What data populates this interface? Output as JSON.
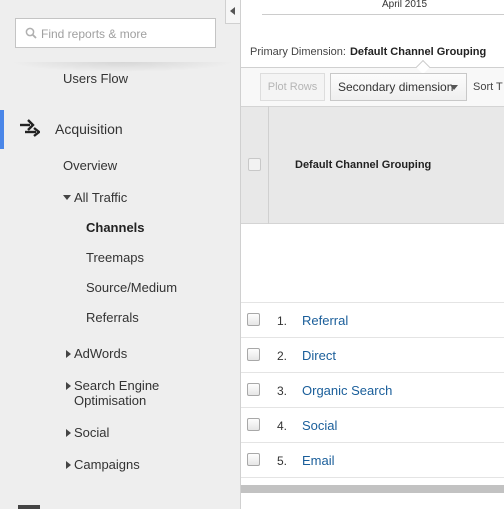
{
  "sidebar": {
    "search_placeholder": "Find reports & more",
    "users_flow": "Users Flow",
    "section_title": "Acquisition",
    "overview": "Overview",
    "all_traffic": "All Traffic",
    "all_traffic_items": [
      "Channels",
      "Treemaps",
      "Source/Medium",
      "Referrals"
    ],
    "adwords": "AdWords",
    "seo_line1": "Search Engine",
    "seo_line2": "Optimisation",
    "social": "Social",
    "campaigns": "Campaigns",
    "accent_color": "#4a86e8"
  },
  "header": {
    "date_label": "April 2015",
    "primary_dimension_label": "Primary Dimension:",
    "primary_dimension_value": "Default Channel Grouping"
  },
  "toolbar": {
    "plot_rows": "Plot Rows",
    "secondary_dimension": "Secondary dimension",
    "sort_type": "Sort T"
  },
  "table": {
    "column_header": "Default Channel Grouping",
    "rows": [
      {
        "index": "1.",
        "label": "Referral"
      },
      {
        "index": "2.",
        "label": "Direct"
      },
      {
        "index": "3.",
        "label": "Organic Search"
      },
      {
        "index": "4.",
        "label": "Social"
      },
      {
        "index": "5.",
        "label": "Email"
      }
    ],
    "link_color": "#1a5e9a"
  }
}
